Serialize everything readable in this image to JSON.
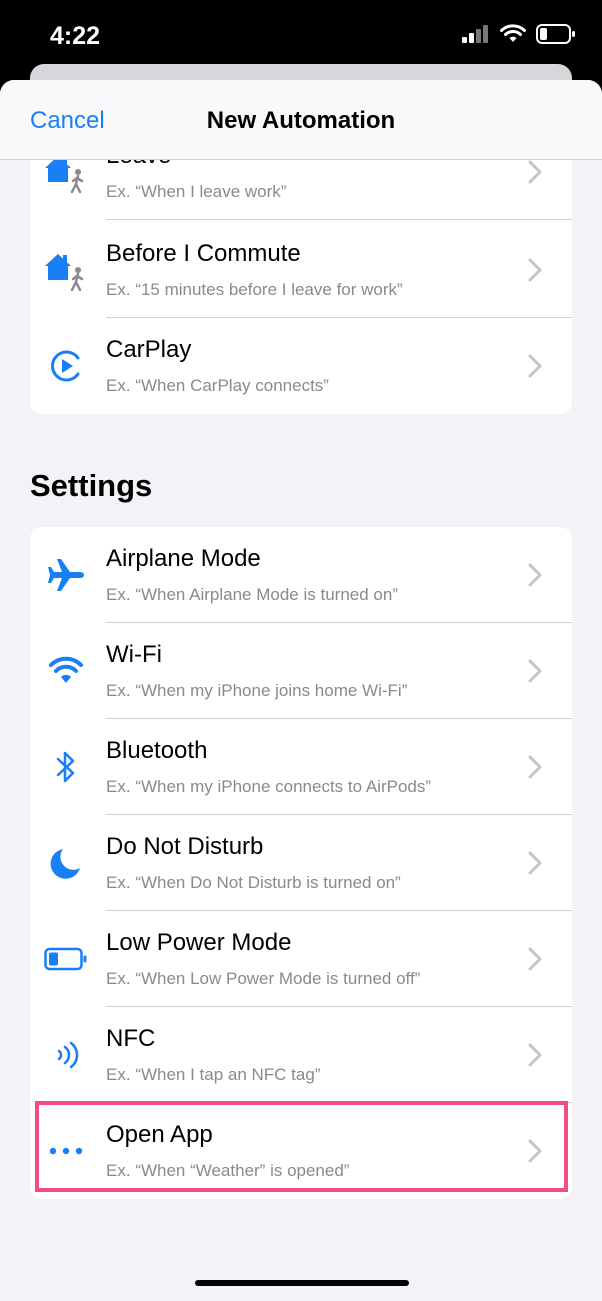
{
  "status": {
    "time": "4:22"
  },
  "nav": {
    "cancel_label": "Cancel",
    "title": "New Automation"
  },
  "travel_items": [
    {
      "title": "Leave",
      "subtitle": "Ex. “When I leave work”",
      "icon": "home-leave-icon"
    },
    {
      "title": "Before I Commute",
      "subtitle": "Ex. “15 minutes before I leave for work”",
      "icon": "home-leave-icon"
    },
    {
      "title": "CarPlay",
      "subtitle": "Ex. “When CarPlay connects”",
      "icon": "carplay-icon"
    }
  ],
  "settings": {
    "title": "Settings",
    "items": [
      {
        "title": "Airplane Mode",
        "subtitle": "Ex. “When Airplane Mode is turned on”",
        "icon": "airplane-icon"
      },
      {
        "title": "Wi-Fi",
        "subtitle": "Ex. “When my iPhone joins home Wi-Fi”",
        "icon": "wifi-icon"
      },
      {
        "title": "Bluetooth",
        "subtitle": "Ex. “When my iPhone connects to AirPods”",
        "icon": "bluetooth-icon"
      },
      {
        "title": "Do Not Disturb",
        "subtitle": "Ex. “When Do Not Disturb is turned on”",
        "icon": "moon-icon"
      },
      {
        "title": "Low Power Mode",
        "subtitle": "Ex. “When Low Power Mode is turned off”",
        "icon": "battery-icon"
      },
      {
        "title": "NFC",
        "subtitle": "Ex. “When I tap an NFC tag”",
        "icon": "nfc-icon"
      },
      {
        "title": "Open App",
        "subtitle": "Ex. “When “Weather” is opened”",
        "icon": "ellipsis-icon"
      }
    ]
  },
  "colors": {
    "accent": "#1a7ef5",
    "highlight": "#ef4c88",
    "background": "#f2f2f7"
  }
}
